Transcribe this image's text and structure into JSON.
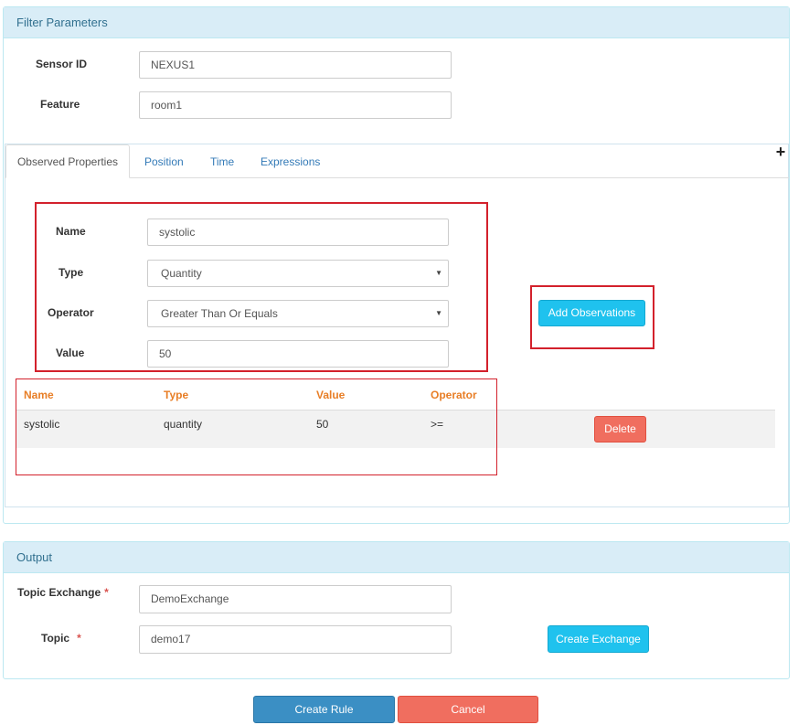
{
  "filter_panel": {
    "title": "Filter Parameters",
    "sensor_id_label": "Sensor ID",
    "sensor_id_value": "NEXUS1",
    "feature_label": "Feature",
    "feature_value": "room1"
  },
  "tabs": {
    "items": [
      "Observed Properties",
      "Position",
      "Time",
      "Expressions"
    ],
    "active": "Observed Properties",
    "add_icon": "plus-icon"
  },
  "observation_form": {
    "name_label": "Name",
    "name_value": "systolic",
    "type_label": "Type",
    "type_value": "Quantity",
    "operator_label": "Operator",
    "operator_value": "Greater Than Or Equals",
    "value_label": "Value",
    "value_value": "50",
    "add_button": "Add Observations"
  },
  "observations_table": {
    "headers": [
      "Name",
      "Type",
      "Value",
      "Operator"
    ],
    "rows": [
      {
        "name": "systolic",
        "type": "quantity",
        "value": "50",
        "operator": ">=",
        "action": "Delete"
      }
    ]
  },
  "output_panel": {
    "title": "Output",
    "topic_exchange_label": "Topic Exchange",
    "topic_exchange_value": "DemoExchange",
    "topic_label": "Topic",
    "topic_value": "demo17",
    "create_exchange_button": "Create Exchange",
    "required_marker": "*"
  },
  "footer": {
    "create_rule_button": "Create Rule",
    "cancel_button": "Cancel"
  },
  "colors": {
    "panel_heading_bg": "#d9edf7",
    "highlight_red": "#d3212c",
    "info_button": "#1fc2ee",
    "danger_button": "#f06e5f",
    "primary_button": "#3b8fc4",
    "table_header": "#e87e26"
  }
}
